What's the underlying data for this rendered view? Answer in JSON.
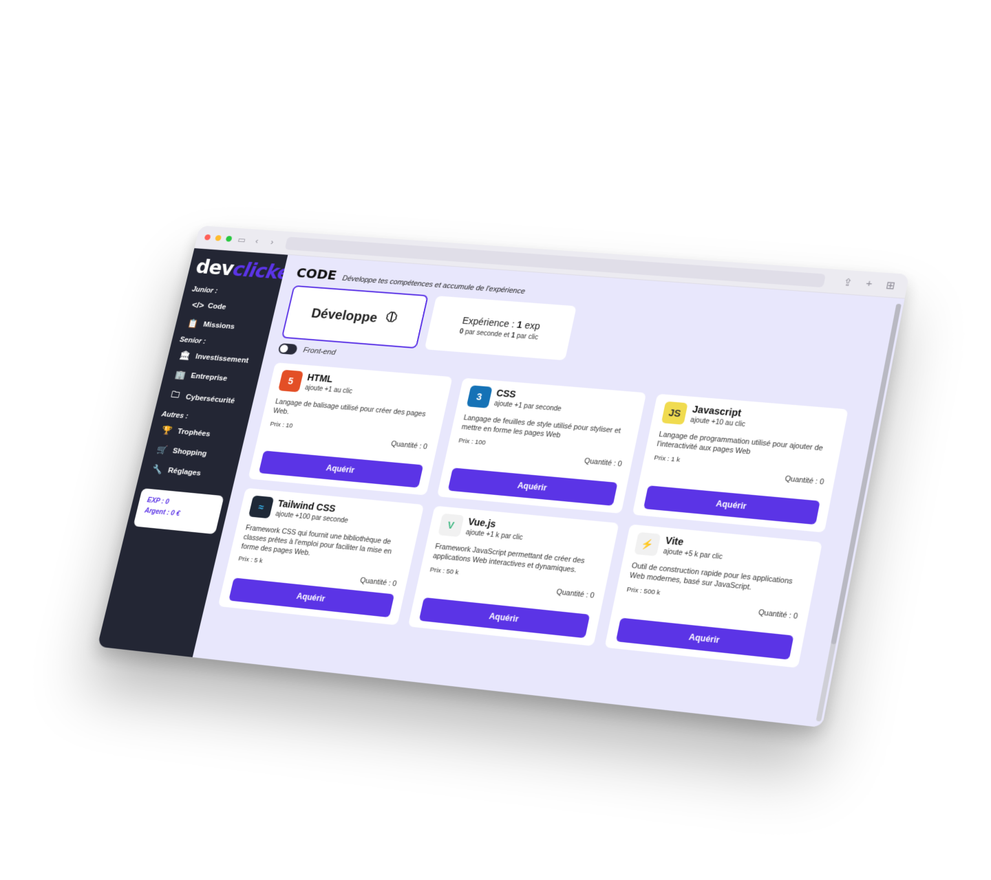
{
  "logo": {
    "part1": "dev",
    "part2": "clicker"
  },
  "sidebar": {
    "groups": [
      {
        "label": "Junior :",
        "items": [
          {
            "label": "Code",
            "icon": "code-icon"
          },
          {
            "label": "Missions",
            "icon": "clipboard-icon"
          }
        ]
      },
      {
        "label": "Senior :",
        "items": [
          {
            "label": "Investissement",
            "icon": "bank-icon"
          },
          {
            "label": "Entreprise",
            "icon": "building-icon"
          },
          {
            "label": "Cybersécurité",
            "icon": "folder-lock-icon"
          }
        ]
      },
      {
        "label": "Autres :",
        "items": [
          {
            "label": "Trophées",
            "icon": "trophy-icon"
          },
          {
            "label": "Shopping",
            "icon": "cart-icon"
          },
          {
            "label": "Réglages",
            "icon": "wrench-icon"
          }
        ]
      }
    ],
    "stats": {
      "exp": "EXP : 0",
      "money": "Argent : 0 €"
    }
  },
  "header": {
    "title": "CODE",
    "subtitle": "Développe tes compétences et accumule de l'expérience"
  },
  "develop": {
    "label": "Développe",
    "icon": "brain-icon"
  },
  "experience": {
    "prefix": "Expérience : ",
    "value": "1",
    "unit": " exp",
    "per_second": "0",
    "per_second_text": " par seconde et ",
    "per_click": "1",
    "per_click_text": " par clic"
  },
  "toggle": {
    "label": "Front-end",
    "on": false
  },
  "cards": [
    {
      "title": "HTML",
      "gain": "ajoute +1 au clic",
      "desc": "Langage de balisage utilisé pour créer des pages Web.",
      "price": "Prix : 10",
      "qty": "Quantité : 0",
      "button": "Aquérir",
      "logo_text": "5",
      "logo_bg": "#e34f26",
      "logo_color": "#ffffff"
    },
    {
      "title": "CSS",
      "gain": "ajoute +1 par seconde",
      "desc": "Langage de feuilles de style utilisé pour styliser et mettre en forme les pages Web",
      "price": "Prix : 100",
      "qty": "Quantité : 0",
      "button": "Aquérir",
      "logo_text": "3",
      "logo_bg": "#1572b6",
      "logo_color": "#ffffff"
    },
    {
      "title": "Javascript",
      "gain": "ajoute +10 au clic",
      "desc": "Langage de programmation utilisé pour ajouter de l'interactivité aux pages Web",
      "price": "Prix : 1 k",
      "qty": "Quantité : 0",
      "button": "Aquérir",
      "logo_text": "JS",
      "logo_bg": "#f0db4f",
      "logo_color": "#323330"
    },
    {
      "title": "Tailwind CSS",
      "gain": "ajoute +100 par seconde",
      "desc": "Framework CSS qui fournit une bibliothèque de classes prêtes à l'emploi pour faciliter la mise en forme des pages Web.",
      "price": "Prix : 5 k",
      "qty": "Quantité : 0",
      "button": "Aquérir",
      "logo_text": "≈",
      "logo_bg": "#1f2937",
      "logo_color": "#38bdf8"
    },
    {
      "title": "Vue.js",
      "gain": "ajoute +1 k par clic",
      "desc": "Framework JavaScript permettant de créer des applications Web interactives et dynamiques.",
      "price": "Prix : 50 k",
      "qty": "Quantité : 0",
      "button": "Aquérir",
      "logo_text": "V",
      "logo_bg": "#f1f1f1",
      "logo_color": "#41b883"
    },
    {
      "title": "Vite",
      "gain": "ajoute +5 k par clic",
      "desc": "Outil de construction rapide pour les applications Web modernes, basé sur JavaScript.",
      "price": "Prix : 500 k",
      "qty": "Quantité : 0",
      "button": "Aquérir",
      "logo_text": "⚡",
      "logo_bg": "#f1f1f1",
      "logo_color": "#9b5cff"
    }
  ]
}
